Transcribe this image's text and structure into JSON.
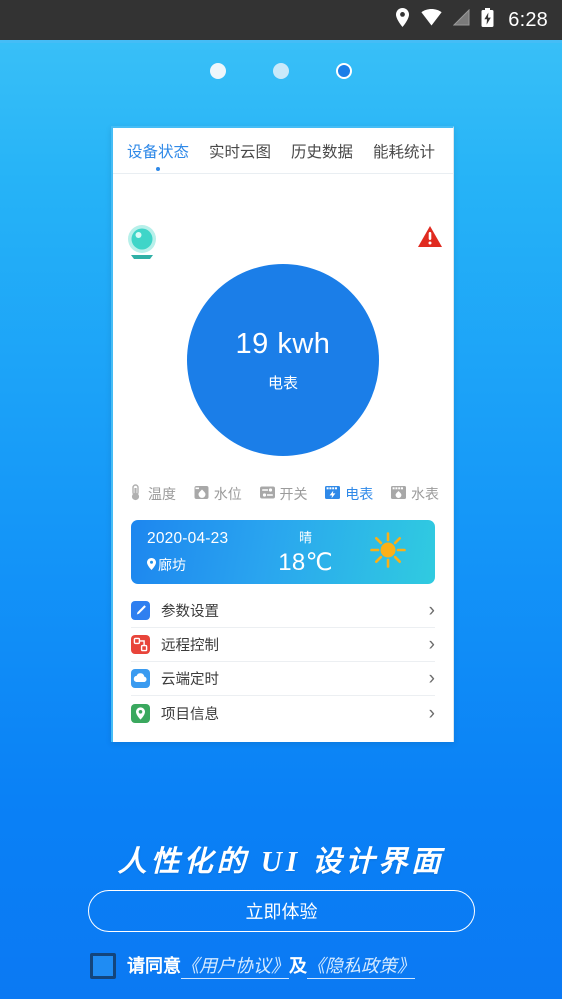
{
  "statusbar": {
    "time": "6:28",
    "icons": [
      "location-pin-icon",
      "wifi-icon",
      "cellular-signal-icon",
      "battery-charging-icon"
    ]
  },
  "pager": {
    "dots": [
      "dot-1",
      "dot-2",
      "dot-3"
    ],
    "active_index": 2
  },
  "card": {
    "tabs": [
      {
        "label": "设备状态",
        "active": true
      },
      {
        "label": "实时云图",
        "active": false
      },
      {
        "label": "历史数据",
        "active": false
      },
      {
        "label": "能耗统计",
        "active": false
      }
    ],
    "status": {
      "device_icon": "device-sensor-icon",
      "alert_icon": "warning-triangle-icon"
    },
    "gauge": {
      "value": "19 kwh",
      "label": "电表",
      "color": "#1b7ee8"
    },
    "device_types": [
      {
        "label": "温度",
        "icon": "thermometer-icon",
        "active": false
      },
      {
        "label": "水位",
        "icon": "water-level-icon",
        "active": false
      },
      {
        "label": "开关",
        "icon": "switch-icon",
        "active": false
      },
      {
        "label": "电表",
        "icon": "electric-meter-icon",
        "active": true
      },
      {
        "label": "水表",
        "icon": "water-meter-icon",
        "active": false
      }
    ],
    "weather": {
      "date": "2020-04-23",
      "location": "廊坊",
      "condition": "晴",
      "temperature": "18℃",
      "icon": "sun-icon"
    },
    "menu": [
      {
        "label": "参数设置",
        "icon": "pencil-icon",
        "color": "#2f7ff0"
      },
      {
        "label": "远程控制",
        "icon": "remote-control-icon",
        "color": "#e8443a"
      },
      {
        "label": "云端定时",
        "icon": "cloud-icon",
        "color": "#3a9bf0"
      },
      {
        "label": "项目信息",
        "icon": "location-pin-icon",
        "color": "#3aa85e"
      }
    ],
    "chevron": "›"
  },
  "promo": {
    "tagline": "人性化的 UI 设计界面",
    "cta_label": "立即体验",
    "agreement": {
      "lead": "请同意",
      "link_1": "《用户协议》",
      "conjunction": "及",
      "link_2": "《隐私政策》",
      "checked": false
    }
  },
  "colors": {
    "brand_blue": "#1b7ee8",
    "accent_cyan": "#45bdf6",
    "alert_red": "#e02b20",
    "sun_orange": "#f9a825"
  }
}
